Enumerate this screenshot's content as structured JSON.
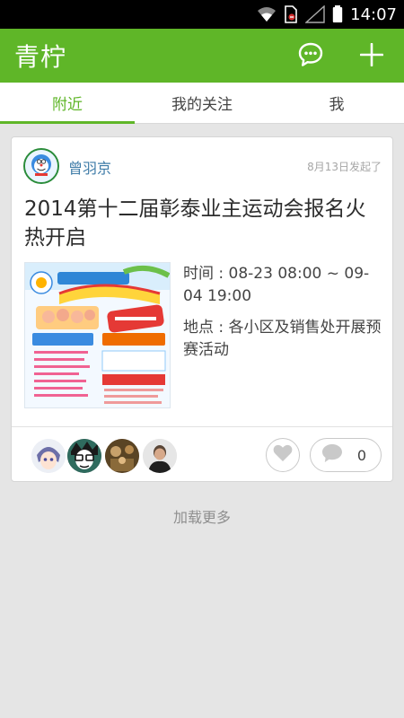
{
  "status_bar": {
    "time": "14:07",
    "icons": [
      "wifi-icon",
      "sim-card-blocked-icon",
      "signal-empty-icon",
      "battery-icon"
    ]
  },
  "app_bar": {
    "title": "青柠",
    "actions": [
      "chat-bubble-icon",
      "add-icon"
    ],
    "color": "#5fb628"
  },
  "tabs": [
    {
      "label": "附近",
      "active": true
    },
    {
      "label": "我的关注",
      "active": false
    },
    {
      "label": "我",
      "active": false
    }
  ],
  "post": {
    "author": "曾羽京",
    "time_ago": "8月13日发起了",
    "title": "2014第十二届彰泰业主运动会报名火热开启",
    "time_line": "时间 : 08-23 08:00 ~ 09-04 19:00",
    "location_line": "地点 : 各小区及销售处开展预赛活动",
    "comment_count": "0"
  },
  "load_more": "加载更多"
}
